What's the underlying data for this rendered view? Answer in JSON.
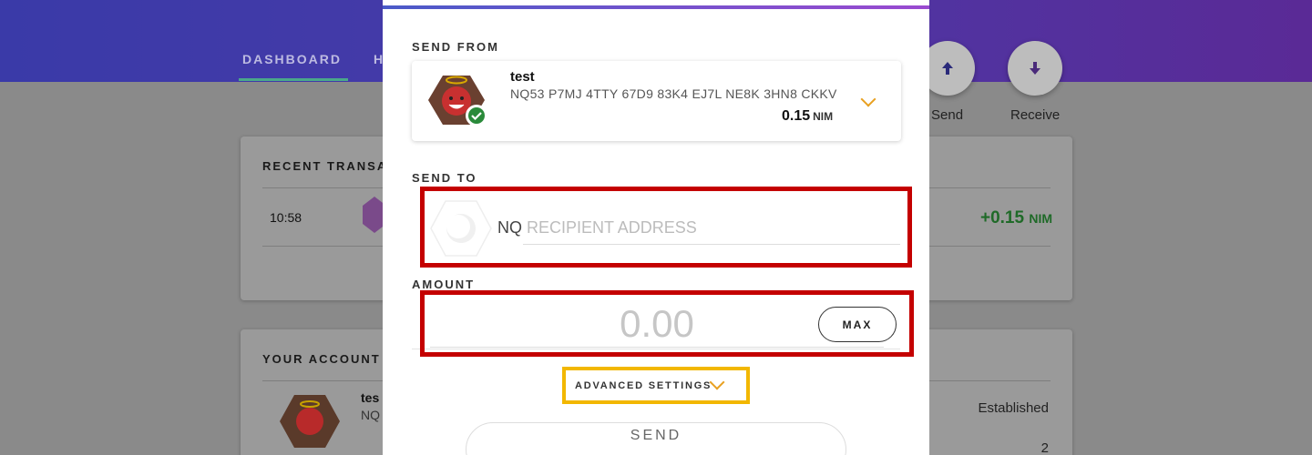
{
  "nav": {
    "tabs": [
      "DASHBOARD",
      "H"
    ]
  },
  "actions": {
    "send_label": "Send",
    "receive_label": "Receive"
  },
  "recent": {
    "title": "RECENT TRANSA",
    "time": "10:58",
    "amount": "+0.15",
    "unit": "NIM"
  },
  "accounts": {
    "title": "YOUR ACCOUNT",
    "name": "tes",
    "address": "NQ",
    "status": "Established",
    "count": "2"
  },
  "modal": {
    "send_from_label": "SEND FROM",
    "account_name": "test",
    "account_address": "NQ53 P7MJ 4TTY 67D9 83K4 EJ7L NE8K 3HN8 CKKV",
    "balance": "0.15",
    "balance_unit": "NIM",
    "send_to_label": "SEND TO",
    "nq_prefix": "NQ",
    "recipient_placeholder": "RECIPIENT ADDRESS",
    "amount_label": "AMOUNT",
    "amount_placeholder": "0.00",
    "max_label": "MAX",
    "advanced_label": "ADVANCED SETTINGS",
    "send_label": "SEND"
  },
  "colors": {
    "highlight_red": "#c40000",
    "highlight_yellow": "#f2b700",
    "chevron_orange": "#e8a020",
    "positive_green": "#1f6a28"
  }
}
